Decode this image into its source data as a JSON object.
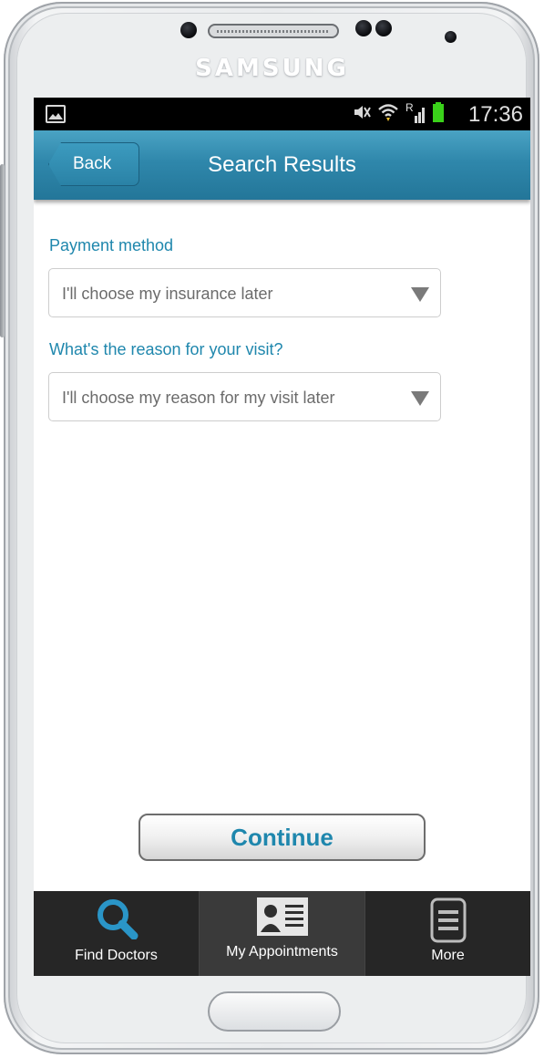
{
  "device": {
    "brand": "SAMSUNG"
  },
  "statusbar": {
    "time": "17:36",
    "network_label": "R",
    "icons": [
      "gallery-icon",
      "mute-icon",
      "wifi-icon",
      "signal-icon",
      "battery-icon"
    ]
  },
  "header": {
    "back_label": "Back",
    "title": "Search Results"
  },
  "form": {
    "payment": {
      "label": "Payment method",
      "value": "I'll choose my insurance later"
    },
    "reason": {
      "label": "What's the reason for your visit?",
      "value": "I'll choose my reason for my visit later"
    }
  },
  "actions": {
    "continue_label": "Continue"
  },
  "tabbar": {
    "tabs": [
      {
        "label": "Find Doctors",
        "icon": "search-icon",
        "active": false
      },
      {
        "label": "My Appointments",
        "icon": "contact-card-icon",
        "active": true
      },
      {
        "label": "More",
        "icon": "menu-icon",
        "active": false
      }
    ]
  },
  "colors": {
    "accent": "#1f87ad",
    "header": "#2f87ab",
    "tabbar": "#262626",
    "battery": "#3ad21a",
    "search_icon": "#2a95c7"
  }
}
